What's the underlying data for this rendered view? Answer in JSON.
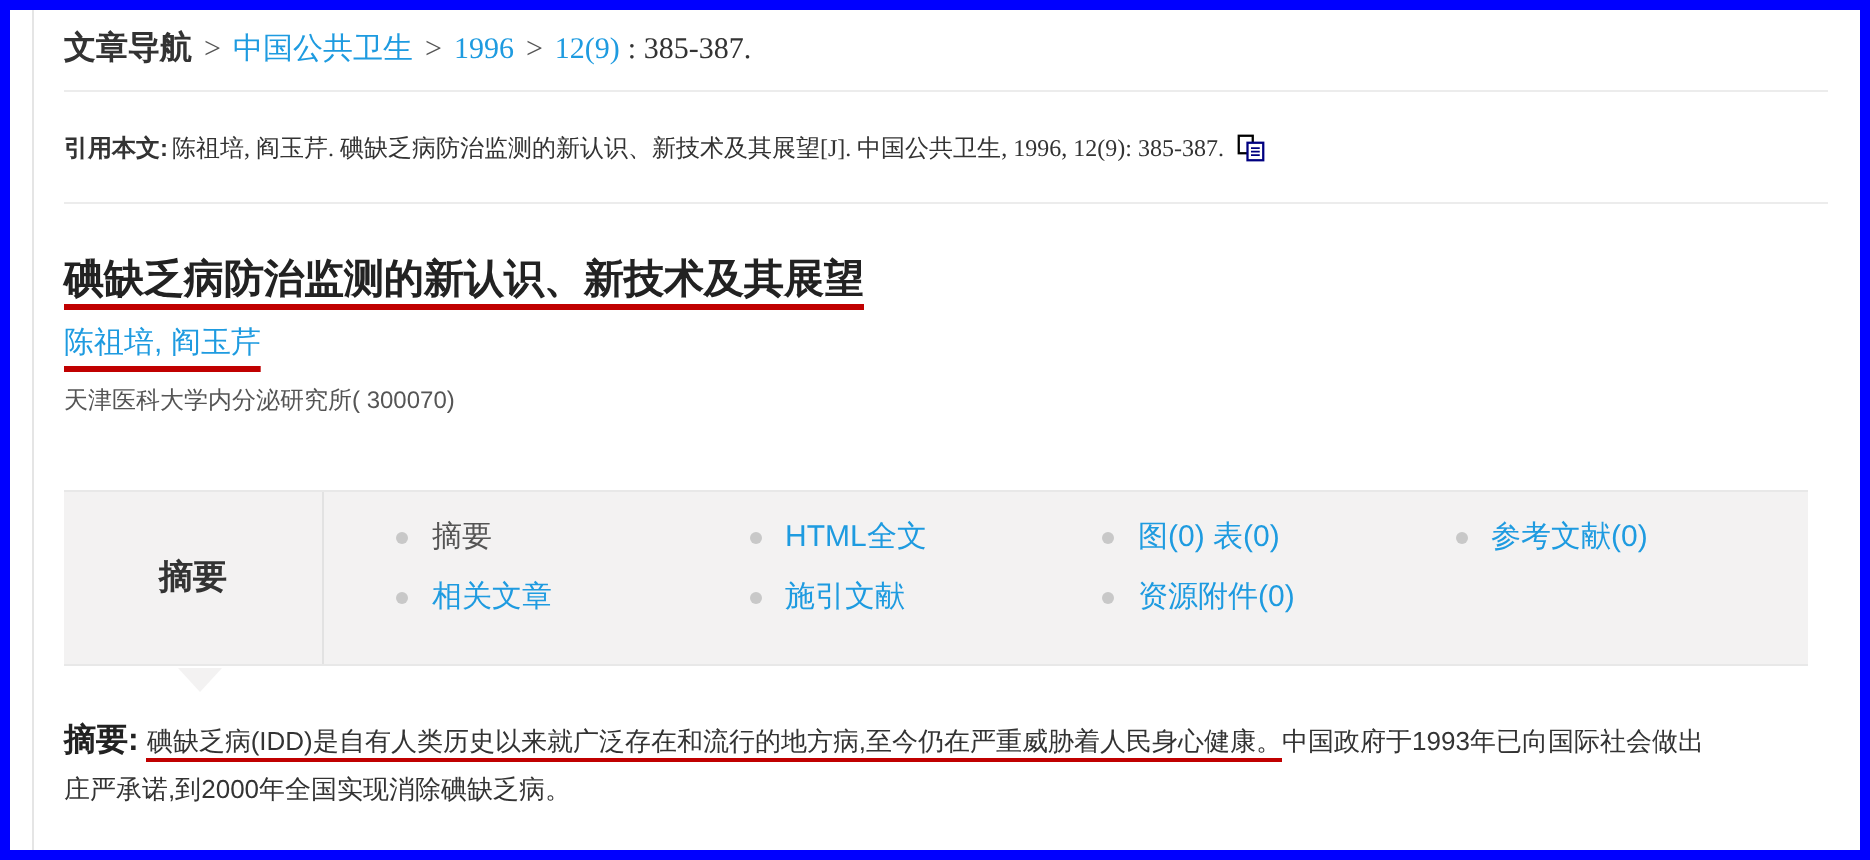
{
  "breadcrumb": {
    "label": "文章导航",
    "items": [
      {
        "separator": ">",
        "text": "中国公共卫生",
        "link": true
      },
      {
        "separator": ">",
        "text": "1996",
        "link": true
      },
      {
        "separator": ">",
        "text": "12(9)",
        "link": true
      }
    ],
    "tail": ": 385-387."
  },
  "citation": {
    "label": "引用本文:",
    "text": "陈祖培, 阎玉芹. 碘缺乏病防治监测的新认识、新技术及其展望[J]. 中国公共卫生, 1996, 12(9): 385-387."
  },
  "title": {
    "text": "碘缺乏病防治监测的新认识、新技术及其展望",
    "underlined": true
  },
  "authors": {
    "text": "陈祖培, 阎玉芹",
    "underlined": true
  },
  "affiliation": "天津医科大学内分泌研究所( 300070)",
  "tabs": {
    "heading": "摘要",
    "items": [
      {
        "text": "摘要",
        "link": false
      },
      {
        "text": "HTML全文",
        "link": true
      },
      {
        "text": "图(0) 表(0)",
        "link": true
      },
      {
        "text": "参考文献(0)",
        "link": true
      },
      {
        "text": "相关文章",
        "link": true
      },
      {
        "text": "施引文献",
        "link": true
      },
      {
        "text": "资源附件(0)",
        "link": true
      }
    ]
  },
  "abstract": {
    "label": "摘要:",
    "segments": [
      {
        "text": "碘缺乏病(IDD)是自有人类历史以来就广泛存在和流行的地方病,至今仍在严重威胁着人民身心健康。",
        "underlined": true
      },
      {
        "text": "中国政府于1993年已向国际社会做出庄严承诺,到2000年全国实现消除碘缺乏病。",
        "underlined": false
      }
    ]
  }
}
